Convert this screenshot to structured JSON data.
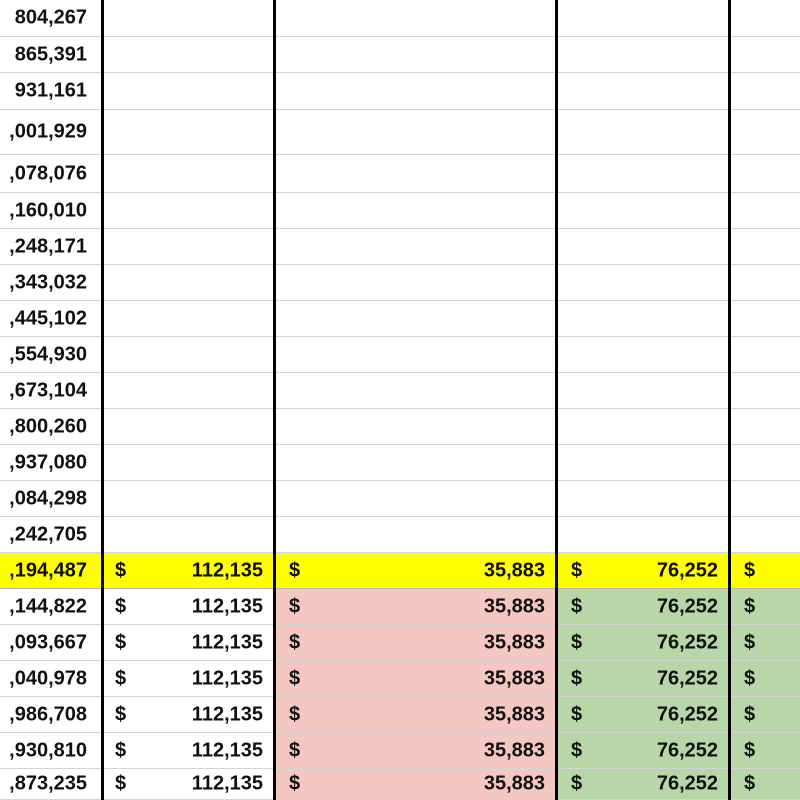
{
  "colors": {
    "highlight_row": "#ffff00",
    "red_fill": "#f4c7c3",
    "green_fill": "#b7d7a8",
    "grid_line": "#d4d4d4",
    "column_border": "#000000"
  },
  "currency_symbol": "$",
  "rows": [
    {
      "col0": "804,267"
    },
    {
      "col0": "865,391"
    },
    {
      "col0": "931,161"
    },
    {
      "col0": ",001,929"
    },
    {
      "col0": ",078,076"
    },
    {
      "col0": ",160,010"
    },
    {
      "col0": ",248,171"
    },
    {
      "col0": ",343,032"
    },
    {
      "col0": ",445,102"
    },
    {
      "col0": ",554,930"
    },
    {
      "col0": ",673,104"
    },
    {
      "col0": ",800,260"
    },
    {
      "col0": ",937,080"
    },
    {
      "col0": ",084,298"
    },
    {
      "col0": ",242,705"
    },
    {
      "col0": ",194,487",
      "col1": "112,135",
      "col2": "35,883",
      "col3": "76,252",
      "col4": "",
      "style": "highlight"
    },
    {
      "col0": ",144,822",
      "col1": "112,135",
      "col2": "35,883",
      "col3": "76,252",
      "col4": "",
      "style": "data"
    },
    {
      "col0": ",093,667",
      "col1": "112,135",
      "col2": "35,883",
      "col3": "76,252",
      "col4": "",
      "style": "data"
    },
    {
      "col0": ",040,978",
      "col1": "112,135",
      "col2": "35,883",
      "col3": "76,252",
      "col4": "",
      "style": "data"
    },
    {
      "col0": ",986,708",
      "col1": "112,135",
      "col2": "35,883",
      "col3": "76,252",
      "col4": "",
      "style": "data"
    },
    {
      "col0": ",930,810",
      "col1": "112,135",
      "col2": "35,883",
      "col3": "76,252",
      "col4": "",
      "style": "data"
    },
    {
      "col0": ",873,235",
      "col1": "112,135",
      "col2": "35,883",
      "col3": "76,252",
      "col4": "",
      "style": "data"
    }
  ]
}
